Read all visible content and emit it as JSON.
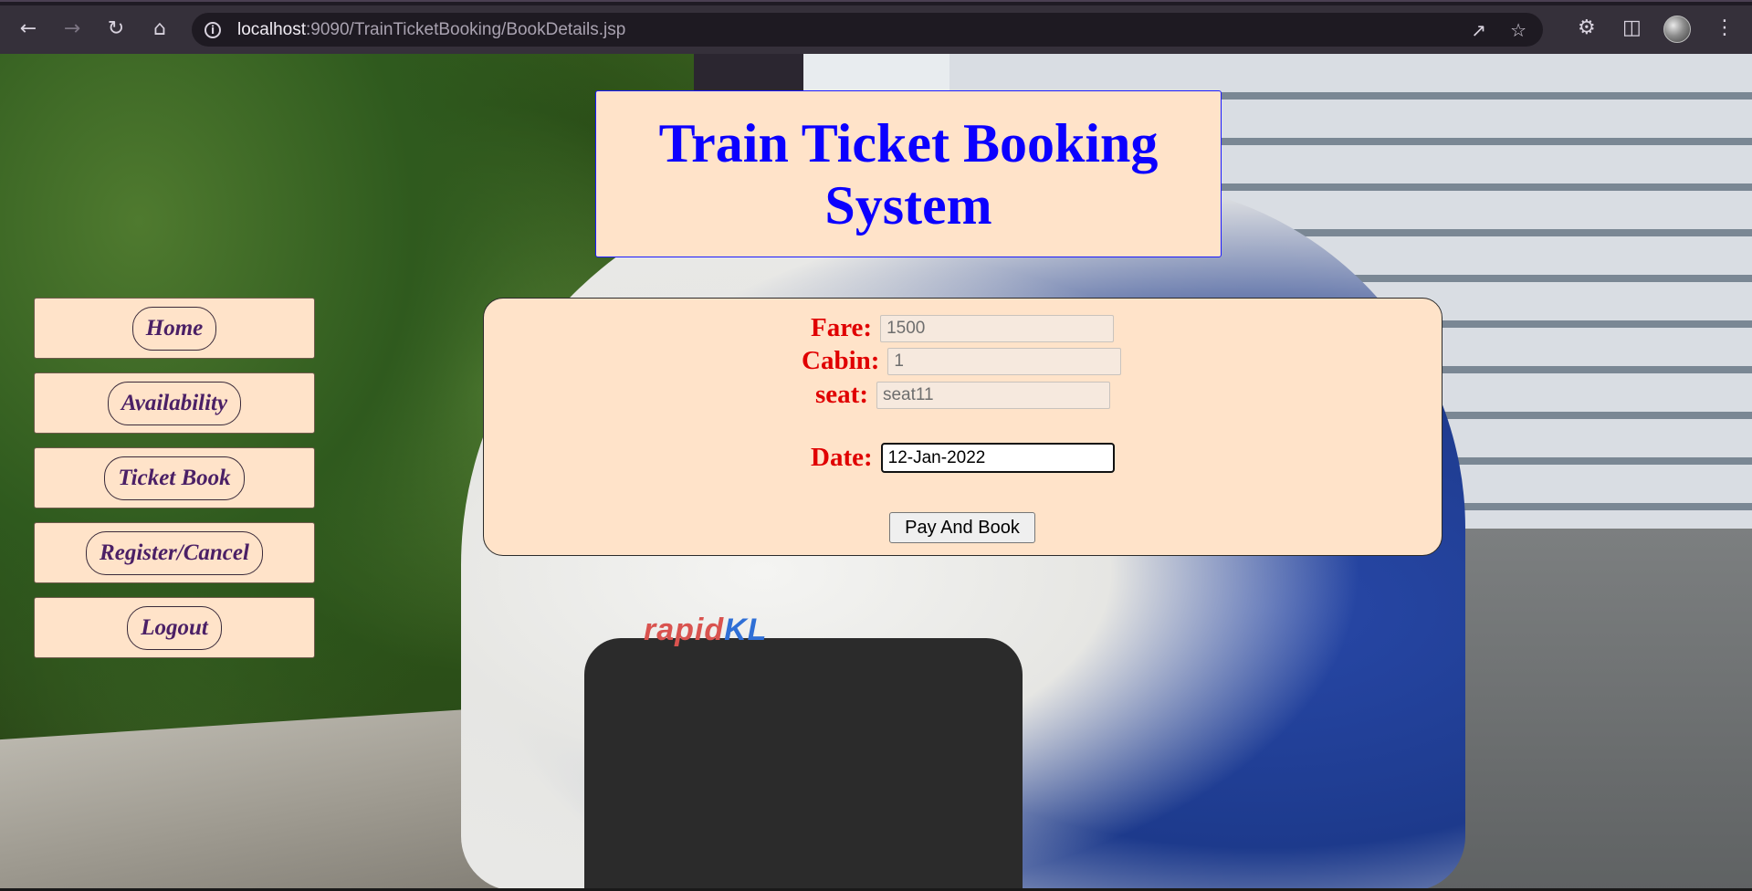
{
  "browser": {
    "url_host": "localhost",
    "url_path": ":9090/TrainTicketBooking/BookDetails.jsp",
    "icons": {
      "back": "back-arrow-icon",
      "forward": "forward-arrow-icon",
      "reload": "reload-icon",
      "home": "home-icon",
      "info": "site-info-icon",
      "share": "share-icon",
      "bookmark": "star-icon",
      "extensions": "puzzle-icon",
      "side_panel": "side-panel-icon",
      "menu": "kebab-menu-icon"
    }
  },
  "header": {
    "title": "Train Ticket Booking System"
  },
  "sidebar": {
    "items": [
      {
        "label": "Home"
      },
      {
        "label": "Availability"
      },
      {
        "label": "Ticket Book"
      },
      {
        "label": "Register/Cancel"
      },
      {
        "label": "Logout"
      }
    ]
  },
  "form": {
    "fare_label": "Fare:",
    "fare_value": "1500",
    "cabin_label": "Cabin:",
    "cabin_value": "1",
    "seat_label": "seat:",
    "seat_value": "seat11",
    "date_label": "Date:",
    "date_value": "12-Jan-2022",
    "submit_label": "Pay And Book"
  },
  "background": {
    "train_brand": "rapid",
    "train_brand_suffix": "KL"
  },
  "colors": {
    "panel_bg": "#ffe3c9",
    "title_color": "#0b00ff",
    "label_color": "#e00000",
    "nav_text": "#4b2066"
  }
}
